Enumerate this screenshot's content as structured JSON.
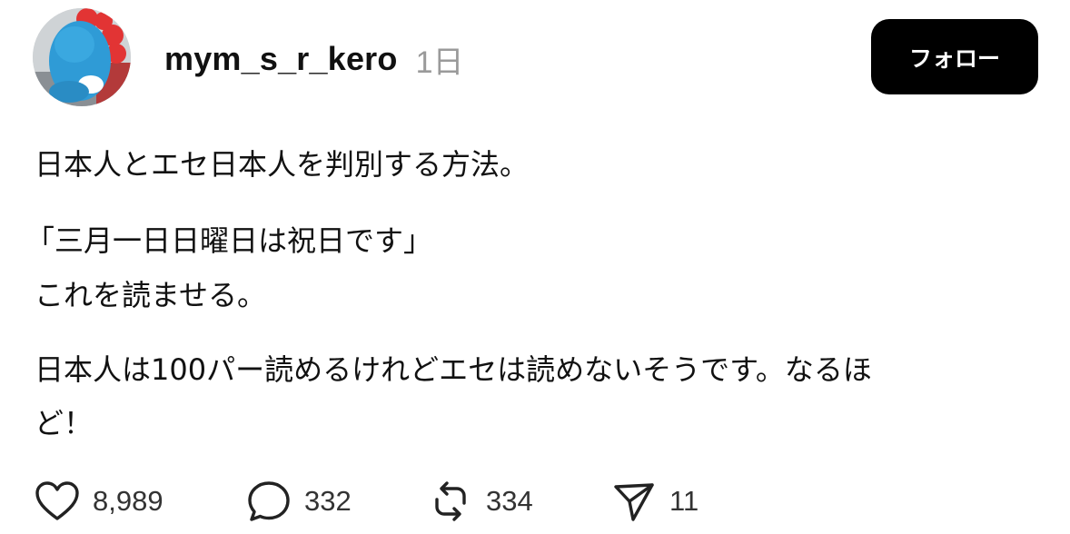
{
  "post": {
    "author": {
      "username": "mym_s_r_kero",
      "avatar": "mascot-avatar"
    },
    "timestamp": "1日",
    "follow_label": "フォロー",
    "body": {
      "line1": "日本人とエセ日本人を判別する方法。",
      "line2": "「三月一日日曜日は祝日です」",
      "line3": "これを読ませる。",
      "line4": "日本人は100パー読めるけれどエセは読めないそうです。なるほ",
      "line5": "ど！"
    },
    "actions": {
      "likes": "8,989",
      "replies": "332",
      "reposts": "334",
      "shares": "11"
    },
    "icons": {
      "like": "heart-icon",
      "reply": "comment-bubble-icon",
      "repost": "repost-arrows-icon",
      "share": "send-arrow-icon"
    },
    "colors": {
      "button_bg": "#000000",
      "button_text": "#ffffff",
      "timestamp": "#9a9a9a",
      "text": "#111111"
    }
  }
}
